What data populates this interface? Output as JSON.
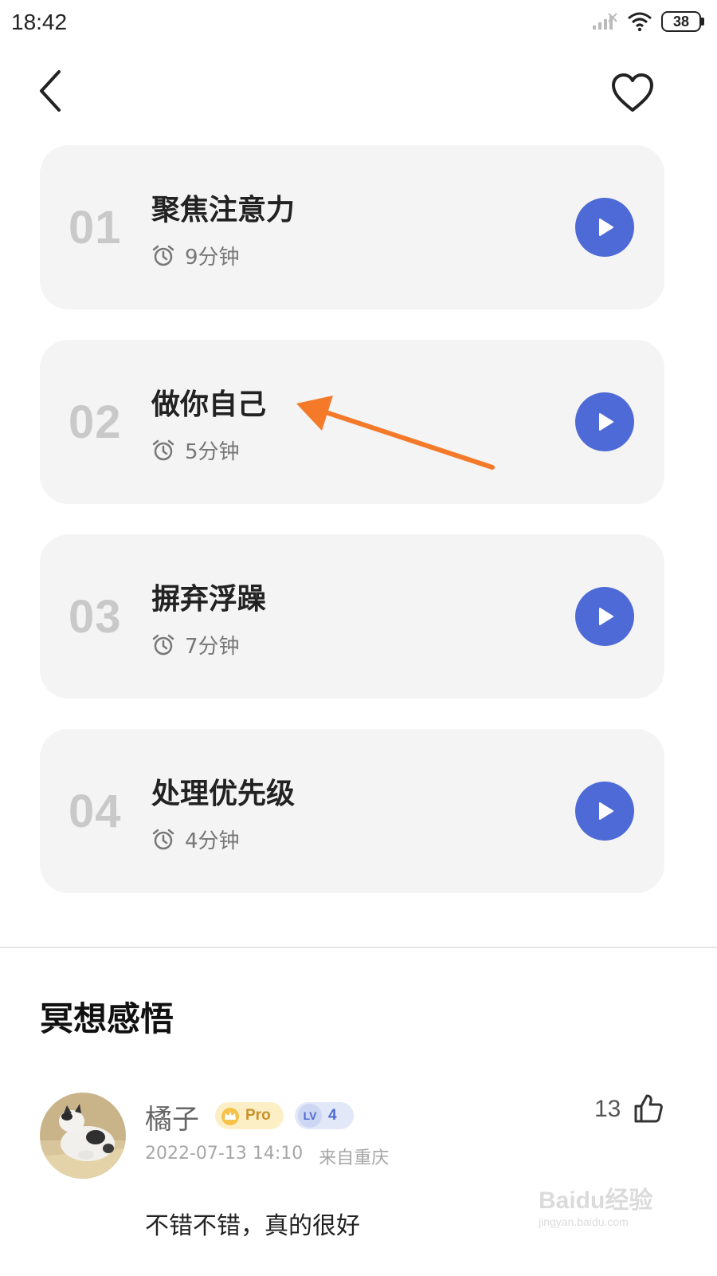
{
  "status_bar": {
    "time": "18:42",
    "battery": "38",
    "icons": [
      "signal-icon",
      "wifi-icon",
      "battery-icon"
    ]
  },
  "header": {
    "back_icon": "back-arrow-icon",
    "favorite_icon": "heart-icon"
  },
  "lessons": [
    {
      "number": "01",
      "title": "聚焦注意力",
      "duration": "9分钟"
    },
    {
      "number": "02",
      "title": "做你自己",
      "duration": "5分钟"
    },
    {
      "number": "03",
      "title": "摒弃浮躁",
      "duration": "7分钟"
    },
    {
      "number": "04",
      "title": "处理优先级",
      "duration": "4分钟"
    }
  ],
  "annotation_arrow_color": "#f47a2a",
  "accent_color": "#4e6ad6",
  "section": {
    "title": "冥想感悟"
  },
  "comment": {
    "user_name": "橘子",
    "pro_badge": "Pro",
    "level_prefix": "LV",
    "level": "4",
    "timestamp": "2022-07-13 14:10",
    "location": "来自重庆",
    "likes": "13",
    "text": "不错不错，真的很好"
  },
  "watermark": {
    "text": "Baidu经验",
    "sub": "jingyan.baidu.com"
  }
}
